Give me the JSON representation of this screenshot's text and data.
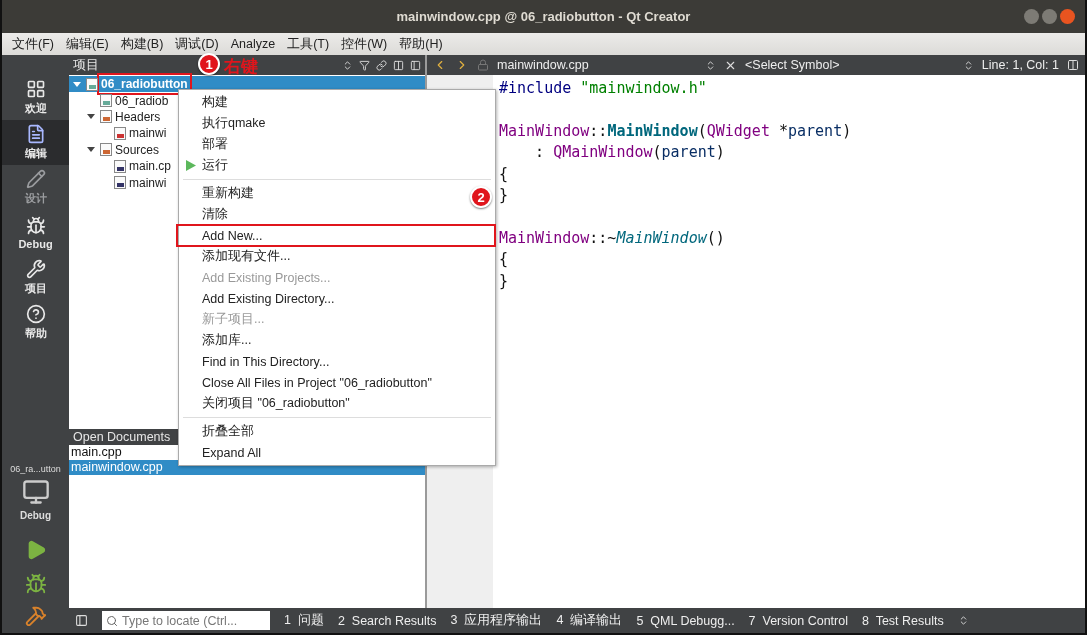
{
  "window": {
    "title": "mainwindow.cpp @ 06_radiobutton - Qt Creator"
  },
  "menu_bar": [
    "文件(F)",
    "编辑(E)",
    "构建(B)",
    "调试(D)",
    "Analyze",
    "工具(T)",
    "控件(W)",
    "帮助(H)"
  ],
  "mode_bar": {
    "modes": [
      {
        "kind": "grid",
        "label": "欢迎",
        "selected": false,
        "disabled": false
      },
      {
        "kind": "edit",
        "label": "编辑",
        "selected": true,
        "disabled": false
      },
      {
        "kind": "design",
        "label": "设计",
        "selected": false,
        "disabled": true
      },
      {
        "kind": "debug",
        "label": "Debug",
        "selected": false,
        "disabled": false
      },
      {
        "kind": "projects",
        "label": "项目",
        "selected": false,
        "disabled": false
      },
      {
        "kind": "help",
        "label": "帮助",
        "selected": false,
        "disabled": false
      }
    ],
    "target": {
      "project": "06_ra...utton",
      "config": "Debug"
    }
  },
  "projects_panel": {
    "title": "项目",
    "tree": [
      {
        "label": "06_radiobutton",
        "kind": "project",
        "selected": true,
        "highlighted": true,
        "expanded": true,
        "children": [
          {
            "label": "06_radiob",
            "kind": "pro",
            "selected": false,
            "highlighted": false
          },
          {
            "label": "Headers",
            "kind": "headers",
            "selected": false,
            "highlighted": false,
            "expanded": true,
            "children": [
              {
                "label": "mainwi",
                "kind": "header",
                "selected": false,
                "highlighted": false
              }
            ]
          },
          {
            "label": "Sources",
            "kind": "sources",
            "selected": false,
            "highlighted": false,
            "expanded": true,
            "children": [
              {
                "label": "main.cp",
                "kind": "source",
                "selected": false,
                "highlighted": false
              },
              {
                "label": "mainwi",
                "kind": "source",
                "selected": false,
                "highlighted": false
              }
            ]
          }
        ]
      }
    ]
  },
  "open_documents": {
    "title": "Open Documents",
    "items": [
      {
        "label": "main.cpp",
        "selected": false
      },
      {
        "label": "mainwindow.cpp",
        "selected": true
      }
    ]
  },
  "editor": {
    "file": "mainwindow.cpp",
    "symbol": "<Select Symbol>",
    "position": "Line: 1, Col: 1",
    "code_blocks": [
      [
        [
          {
            "kind": "preproc",
            "text": "#include "
          },
          {
            "kind": "string",
            "text": "\"mainwindow.h\""
          }
        ]
      ],
      [
        [
          {
            "kind": "type",
            "text": "MainWindow"
          },
          {
            "kind": "plain",
            "text": "::"
          },
          {
            "kind": "func",
            "text": "MainWindow"
          },
          {
            "kind": "plain",
            "text": "("
          },
          {
            "kind": "type",
            "text": "QWidget"
          },
          {
            "kind": "plain",
            "text": " *"
          },
          {
            "kind": "param",
            "text": "parent"
          },
          {
            "kind": "plain",
            "text": ")"
          }
        ],
        [
          {
            "kind": "plain",
            "text": "    : "
          },
          {
            "kind": "type",
            "text": "QMainWindow"
          },
          {
            "kind": "plain",
            "text": "("
          },
          {
            "kind": "param",
            "text": "parent"
          },
          {
            "kind": "plain",
            "text": ")"
          }
        ],
        [
          {
            "kind": "plain",
            "text": "{"
          }
        ],
        [
          {
            "kind": "plain",
            "text": "}"
          }
        ]
      ],
      [
        [
          {
            "kind": "type",
            "text": "MainWindow"
          },
          {
            "kind": "plain",
            "text": "::~"
          },
          {
            "kind": "virtual",
            "text": "MainWindow"
          },
          {
            "kind": "plain",
            "text": "()"
          }
        ],
        [
          {
            "kind": "plain",
            "text": "{"
          }
        ],
        [
          {
            "kind": "plain",
            "text": "}"
          }
        ]
      ]
    ]
  },
  "context_menu": [
    {
      "kind": "item",
      "label": "构建",
      "disabled": false,
      "highlighted": false
    },
    {
      "kind": "item",
      "label": "执行qmake",
      "disabled": false,
      "highlighted": false
    },
    {
      "kind": "item",
      "label": "部署",
      "disabled": false,
      "highlighted": false
    },
    {
      "kind": "run",
      "label": "运行",
      "disabled": false,
      "highlighted": false
    },
    {
      "kind": "separator"
    },
    {
      "kind": "item",
      "label": "重新构建",
      "disabled": false,
      "highlighted": false
    },
    {
      "kind": "item",
      "label": "清除",
      "disabled": false,
      "highlighted": false
    },
    {
      "kind": "item",
      "label": "Add New...",
      "disabled": false,
      "highlighted": true
    },
    {
      "kind": "item",
      "label": "添加现有文件...",
      "disabled": false,
      "highlighted": false
    },
    {
      "kind": "item",
      "label": "Add Existing Projects...",
      "disabled": true,
      "highlighted": false
    },
    {
      "kind": "item",
      "label": "Add Existing Directory...",
      "disabled": false,
      "highlighted": false
    },
    {
      "kind": "item",
      "label": "新子项目...",
      "disabled": true,
      "highlighted": false
    },
    {
      "kind": "item",
      "label": "添加库...",
      "disabled": false,
      "highlighted": false
    },
    {
      "kind": "item",
      "label": "Find in This Directory...",
      "disabled": false,
      "highlighted": false
    },
    {
      "kind": "item",
      "label": "Close All Files in Project \"06_radiobutton\"",
      "disabled": false,
      "highlighted": false
    },
    {
      "kind": "item",
      "label": "关闭项目 \"06_radiobutton\"",
      "disabled": false,
      "highlighted": false
    },
    {
      "kind": "separator"
    },
    {
      "kind": "item",
      "label": "折叠全部",
      "disabled": false,
      "highlighted": false
    },
    {
      "kind": "item",
      "label": "Expand All",
      "disabled": false,
      "highlighted": false
    }
  ],
  "status_bar": {
    "locate_placeholder": "Type to locate (Ctrl...",
    "panes": [
      {
        "number": "1",
        "label": "问题"
      },
      {
        "number": "2",
        "label": "Search Results"
      },
      {
        "number": "3",
        "label": "应用程序输出"
      },
      {
        "number": "4",
        "label": "编译输出"
      },
      {
        "number": "5",
        "label": "QML Debugg..."
      },
      {
        "number": "7",
        "label": "Version Control"
      },
      {
        "number": "8",
        "label": "Test Results"
      }
    ]
  },
  "annotations": [
    {
      "number": "1",
      "note": "右键"
    },
    {
      "number": "2"
    }
  ]
}
